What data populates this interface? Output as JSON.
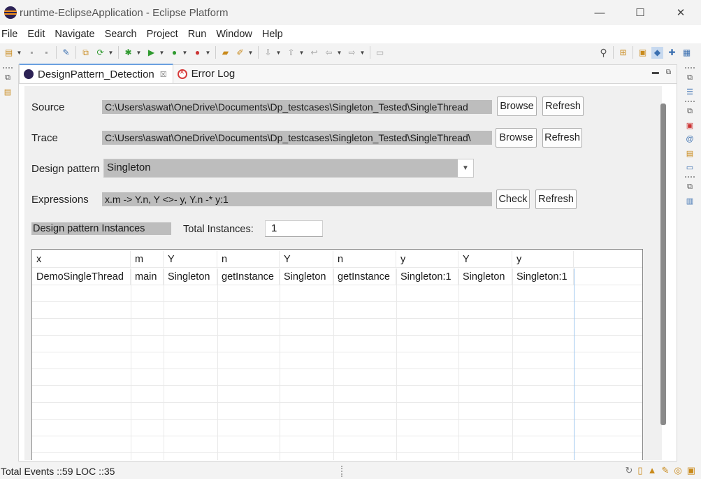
{
  "window": {
    "title": "runtime-EclipseApplication - Eclipse Platform",
    "minimize": "—",
    "maximize": "☐",
    "close": "✕"
  },
  "menu": [
    "File",
    "Edit",
    "Navigate",
    "Search",
    "Project",
    "Run",
    "Window",
    "Help"
  ],
  "tabs": [
    {
      "label": "DesignPattern_Detection",
      "close": "☒",
      "icon": "design-pattern-icon"
    },
    {
      "label": "Error Log",
      "icon": "error-log-icon"
    }
  ],
  "form": {
    "source_label": "Source",
    "source_value": "C:\\Users\\aswat\\OneDrive\\Documents\\Dp_testcases\\Singleton_Tested\\SingleThread",
    "trace_label": "Trace",
    "trace_value": "C:\\Users\\aswat\\OneDrive\\Documents\\Dp_testcases\\Singleton_Tested\\SingleThread\\",
    "browse_label": "Browse",
    "refresh_label": "Refresh",
    "design_pattern_label": "Design pattern",
    "design_pattern_value": "Singleton",
    "expressions_label": "Expressions",
    "expressions_value": "x.m -> Y.n, Y <>- y, Y.n -* y:1",
    "check_label": "Check",
    "instances_label": "Design pattern Instances",
    "total_instances_label": "Total Instances:",
    "total_instances_value": "1"
  },
  "table": {
    "columns": [
      "x",
      "m",
      "Y",
      "n",
      "Y",
      "n",
      "y",
      "Y",
      "y"
    ],
    "rows": [
      [
        "DemoSingleThread",
        "main",
        "Singleton",
        "getInstance",
        "Singleton",
        "getInstance",
        "Singleton:1",
        "Singleton",
        "Singleton:1"
      ]
    ]
  },
  "status": {
    "text": "Total Events ::59  LOC ::35"
  },
  "colors": {
    "field_bg": "#bdbdbd",
    "tab_accent": "#6aa0e0",
    "eclipse_purple": "#2c2255",
    "eclipse_orange": "#f7941e"
  }
}
